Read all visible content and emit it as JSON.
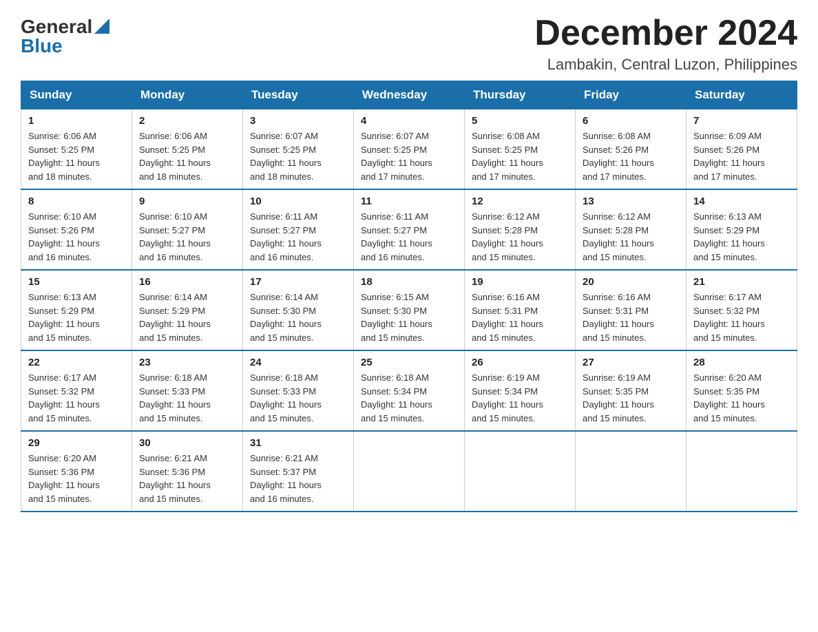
{
  "header": {
    "logo_general": "General",
    "logo_blue": "Blue",
    "month_title": "December 2024",
    "location": "Lambakin, Central Luzon, Philippines"
  },
  "days_of_week": [
    "Sunday",
    "Monday",
    "Tuesday",
    "Wednesday",
    "Thursday",
    "Friday",
    "Saturday"
  ],
  "weeks": [
    [
      {
        "day": "1",
        "sunrise": "6:06 AM",
        "sunset": "5:25 PM",
        "daylight": "11 hours and 18 minutes."
      },
      {
        "day": "2",
        "sunrise": "6:06 AM",
        "sunset": "5:25 PM",
        "daylight": "11 hours and 18 minutes."
      },
      {
        "day": "3",
        "sunrise": "6:07 AM",
        "sunset": "5:25 PM",
        "daylight": "11 hours and 18 minutes."
      },
      {
        "day": "4",
        "sunrise": "6:07 AM",
        "sunset": "5:25 PM",
        "daylight": "11 hours and 17 minutes."
      },
      {
        "day": "5",
        "sunrise": "6:08 AM",
        "sunset": "5:25 PM",
        "daylight": "11 hours and 17 minutes."
      },
      {
        "day": "6",
        "sunrise": "6:08 AM",
        "sunset": "5:26 PM",
        "daylight": "11 hours and 17 minutes."
      },
      {
        "day": "7",
        "sunrise": "6:09 AM",
        "sunset": "5:26 PM",
        "daylight": "11 hours and 17 minutes."
      }
    ],
    [
      {
        "day": "8",
        "sunrise": "6:10 AM",
        "sunset": "5:26 PM",
        "daylight": "11 hours and 16 minutes."
      },
      {
        "day": "9",
        "sunrise": "6:10 AM",
        "sunset": "5:27 PM",
        "daylight": "11 hours and 16 minutes."
      },
      {
        "day": "10",
        "sunrise": "6:11 AM",
        "sunset": "5:27 PM",
        "daylight": "11 hours and 16 minutes."
      },
      {
        "day": "11",
        "sunrise": "6:11 AM",
        "sunset": "5:27 PM",
        "daylight": "11 hours and 16 minutes."
      },
      {
        "day": "12",
        "sunrise": "6:12 AM",
        "sunset": "5:28 PM",
        "daylight": "11 hours and 15 minutes."
      },
      {
        "day": "13",
        "sunrise": "6:12 AM",
        "sunset": "5:28 PM",
        "daylight": "11 hours and 15 minutes."
      },
      {
        "day": "14",
        "sunrise": "6:13 AM",
        "sunset": "5:29 PM",
        "daylight": "11 hours and 15 minutes."
      }
    ],
    [
      {
        "day": "15",
        "sunrise": "6:13 AM",
        "sunset": "5:29 PM",
        "daylight": "11 hours and 15 minutes."
      },
      {
        "day": "16",
        "sunrise": "6:14 AM",
        "sunset": "5:29 PM",
        "daylight": "11 hours and 15 minutes."
      },
      {
        "day": "17",
        "sunrise": "6:14 AM",
        "sunset": "5:30 PM",
        "daylight": "11 hours and 15 minutes."
      },
      {
        "day": "18",
        "sunrise": "6:15 AM",
        "sunset": "5:30 PM",
        "daylight": "11 hours and 15 minutes."
      },
      {
        "day": "19",
        "sunrise": "6:16 AM",
        "sunset": "5:31 PM",
        "daylight": "11 hours and 15 minutes."
      },
      {
        "day": "20",
        "sunrise": "6:16 AM",
        "sunset": "5:31 PM",
        "daylight": "11 hours and 15 minutes."
      },
      {
        "day": "21",
        "sunrise": "6:17 AM",
        "sunset": "5:32 PM",
        "daylight": "11 hours and 15 minutes."
      }
    ],
    [
      {
        "day": "22",
        "sunrise": "6:17 AM",
        "sunset": "5:32 PM",
        "daylight": "11 hours and 15 minutes."
      },
      {
        "day": "23",
        "sunrise": "6:18 AM",
        "sunset": "5:33 PM",
        "daylight": "11 hours and 15 minutes."
      },
      {
        "day": "24",
        "sunrise": "6:18 AM",
        "sunset": "5:33 PM",
        "daylight": "11 hours and 15 minutes."
      },
      {
        "day": "25",
        "sunrise": "6:18 AM",
        "sunset": "5:34 PM",
        "daylight": "11 hours and 15 minutes."
      },
      {
        "day": "26",
        "sunrise": "6:19 AM",
        "sunset": "5:34 PM",
        "daylight": "11 hours and 15 minutes."
      },
      {
        "day": "27",
        "sunrise": "6:19 AM",
        "sunset": "5:35 PM",
        "daylight": "11 hours and 15 minutes."
      },
      {
        "day": "28",
        "sunrise": "6:20 AM",
        "sunset": "5:35 PM",
        "daylight": "11 hours and 15 minutes."
      }
    ],
    [
      {
        "day": "29",
        "sunrise": "6:20 AM",
        "sunset": "5:36 PM",
        "daylight": "11 hours and 15 minutes."
      },
      {
        "day": "30",
        "sunrise": "6:21 AM",
        "sunset": "5:36 PM",
        "daylight": "11 hours and 15 minutes."
      },
      {
        "day": "31",
        "sunrise": "6:21 AM",
        "sunset": "5:37 PM",
        "daylight": "11 hours and 16 minutes."
      },
      null,
      null,
      null,
      null
    ]
  ],
  "labels": {
    "sunrise": "Sunrise:",
    "sunset": "Sunset:",
    "daylight": "Daylight:"
  }
}
